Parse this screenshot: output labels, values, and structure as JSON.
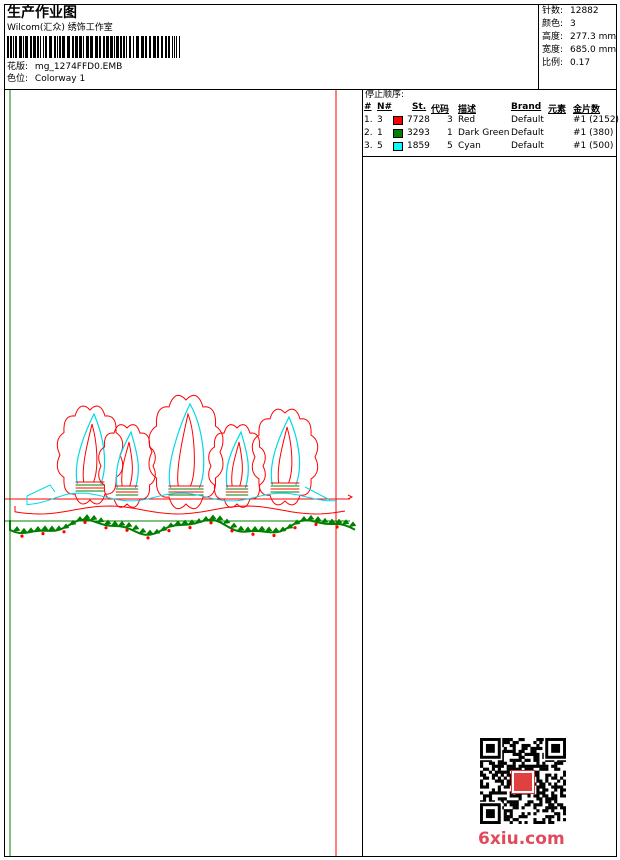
{
  "header": {
    "title": "生产作业图",
    "company": "Wilcom(汇众) 绣饰工作室",
    "design_label": "花版:",
    "design_value": "mg_1274FFD0.EMB",
    "colorway_label": "色位:",
    "colorway_value": "Colorway 1"
  },
  "stats": [
    {
      "label": "针数:",
      "value": "12882"
    },
    {
      "label": "颜色:",
      "value": "3"
    },
    {
      "label": "高度:",
      "value": "277.3 mm"
    },
    {
      "label": "宽度:",
      "value": "685.0 mm"
    },
    {
      "label": "比例:",
      "value": "0.17"
    }
  ],
  "stop_sequence": {
    "title": "停止顺序:",
    "columns": [
      "#",
      "N#",
      "St.",
      "代码",
      "描述",
      "Brand",
      "元素",
      "金片数"
    ],
    "rows": [
      {
        "num": "1.",
        "n": "3",
        "color": "#ff0000",
        "st": "7728",
        "code": "3",
        "desc": "Red",
        "brand": "Default",
        "elem": "",
        "seq": "#1 (2152)"
      },
      {
        "num": "2.",
        "n": "1",
        "color": "#008000",
        "st": "3293",
        "code": "1",
        "desc": "Dark Green",
        "brand": "Default",
        "elem": "",
        "seq": "#1 (380)"
      },
      {
        "num": "3.",
        "n": "5",
        "color": "#00ffff",
        "st": "1859",
        "code": "5",
        "desc": "Cyan",
        "brand": "Default",
        "elem": "",
        "seq": "#1 (500)"
      }
    ]
  },
  "colors": {
    "red": "#ff0000",
    "green": "#008000",
    "cyan": "#00d8e8",
    "frame": "#000000"
  },
  "watermark": {
    "text": "6xiu.com",
    "seal_text": "以技会友"
  }
}
